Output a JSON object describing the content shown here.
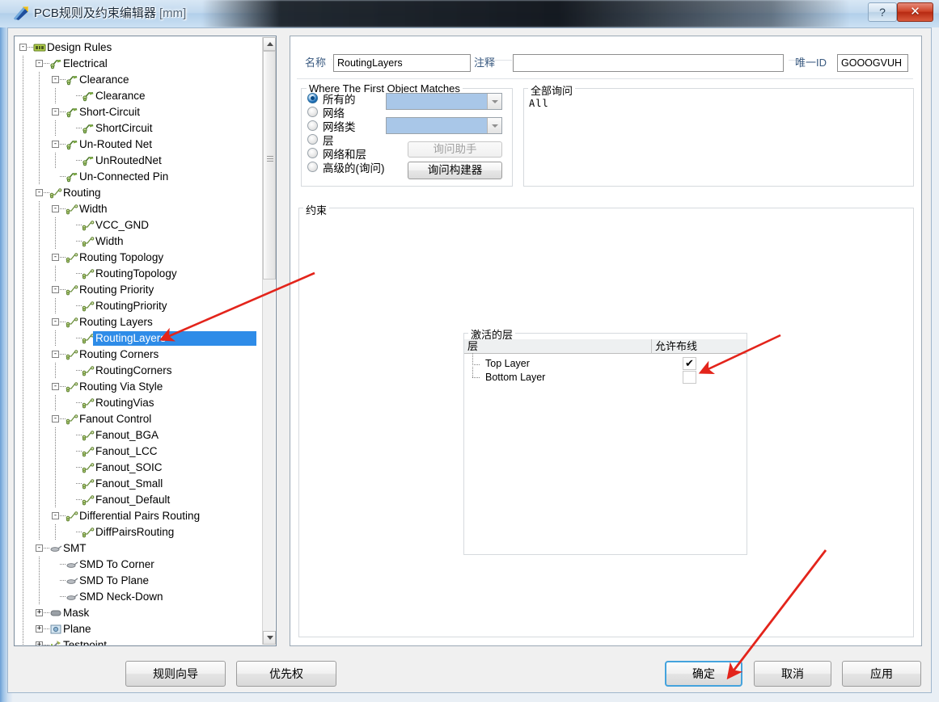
{
  "window": {
    "title": "PCB规则及约束编辑器",
    "unit": "[mm]",
    "icon": "pcb-rules-icon",
    "help_label": "?",
    "close_label": "✕"
  },
  "tree": {
    "items": [
      {
        "label": "Design Rules",
        "depth": 0,
        "expander": "-",
        "icon": "design-rules-icon"
      },
      {
        "label": "Electrical",
        "depth": 1,
        "expander": "-",
        "icon": "electrical-icon"
      },
      {
        "label": "Clearance",
        "depth": 2,
        "expander": "-",
        "icon": "electrical-icon"
      },
      {
        "label": "Clearance",
        "depth": 3,
        "expander": "",
        "icon": "electrical-icon"
      },
      {
        "label": "Short-Circuit",
        "depth": 2,
        "expander": "-",
        "icon": "electrical-icon"
      },
      {
        "label": "ShortCircuit",
        "depth": 3,
        "expander": "",
        "icon": "electrical-icon"
      },
      {
        "label": "Un-Routed Net",
        "depth": 2,
        "expander": "-",
        "icon": "electrical-icon"
      },
      {
        "label": "UnRoutedNet",
        "depth": 3,
        "expander": "",
        "icon": "electrical-icon"
      },
      {
        "label": "Un-Connected Pin",
        "depth": 2,
        "expander": "",
        "icon": "electrical-icon"
      },
      {
        "label": "Routing",
        "depth": 1,
        "expander": "-",
        "icon": "routing-icon"
      },
      {
        "label": "Width",
        "depth": 2,
        "expander": "-",
        "icon": "routing-icon"
      },
      {
        "label": "VCC_GND",
        "depth": 3,
        "expander": "",
        "icon": "routing-icon"
      },
      {
        "label": "Width",
        "depth": 3,
        "expander": "",
        "icon": "routing-icon"
      },
      {
        "label": "Routing Topology",
        "depth": 2,
        "expander": "-",
        "icon": "routing-icon"
      },
      {
        "label": "RoutingTopology",
        "depth": 3,
        "expander": "",
        "icon": "routing-icon"
      },
      {
        "label": "Routing Priority",
        "depth": 2,
        "expander": "-",
        "icon": "routing-icon"
      },
      {
        "label": "RoutingPriority",
        "depth": 3,
        "expander": "",
        "icon": "routing-icon"
      },
      {
        "label": "Routing Layers",
        "depth": 2,
        "expander": "-",
        "icon": "routing-icon"
      },
      {
        "label": "RoutingLayers",
        "depth": 3,
        "expander": "",
        "icon": "routing-icon",
        "selected": true
      },
      {
        "label": "Routing Corners",
        "depth": 2,
        "expander": "-",
        "icon": "routing-icon"
      },
      {
        "label": "RoutingCorners",
        "depth": 3,
        "expander": "",
        "icon": "routing-icon"
      },
      {
        "label": "Routing Via Style",
        "depth": 2,
        "expander": "-",
        "icon": "routing-icon"
      },
      {
        "label": "RoutingVias",
        "depth": 3,
        "expander": "",
        "icon": "routing-icon"
      },
      {
        "label": "Fanout Control",
        "depth": 2,
        "expander": "-",
        "icon": "routing-icon"
      },
      {
        "label": "Fanout_BGA",
        "depth": 3,
        "expander": "",
        "icon": "routing-icon"
      },
      {
        "label": "Fanout_LCC",
        "depth": 3,
        "expander": "",
        "icon": "routing-icon"
      },
      {
        "label": "Fanout_SOIC",
        "depth": 3,
        "expander": "",
        "icon": "routing-icon"
      },
      {
        "label": "Fanout_Small",
        "depth": 3,
        "expander": "",
        "icon": "routing-icon"
      },
      {
        "label": "Fanout_Default",
        "depth": 3,
        "expander": "",
        "icon": "routing-icon"
      },
      {
        "label": "Differential Pairs Routing",
        "depth": 2,
        "expander": "-",
        "icon": "routing-icon"
      },
      {
        "label": "DiffPairsRouting",
        "depth": 3,
        "expander": "",
        "icon": "routing-icon"
      },
      {
        "label": "SMT",
        "depth": 1,
        "expander": "-",
        "icon": "smt-icon"
      },
      {
        "label": "SMD To Corner",
        "depth": 2,
        "expander": "",
        "icon": "smt-icon"
      },
      {
        "label": "SMD To Plane",
        "depth": 2,
        "expander": "",
        "icon": "smt-icon"
      },
      {
        "label": "SMD Neck-Down",
        "depth": 2,
        "expander": "",
        "icon": "smt-icon"
      },
      {
        "label": "Mask",
        "depth": 1,
        "expander": "+",
        "icon": "mask-icon"
      },
      {
        "label": "Plane",
        "depth": 1,
        "expander": "+",
        "icon": "plane-icon"
      },
      {
        "label": "Testpoint",
        "depth": 1,
        "expander": "+",
        "icon": "testpoint-icon"
      }
    ]
  },
  "header": {
    "name_label": "名称",
    "name_value": "RoutingLayers",
    "comment_label": "注释",
    "comment_value": "",
    "unique_id_label": "唯一ID",
    "unique_id_value": "GOOOGVUH"
  },
  "match": {
    "group_title": "Where The First Object Matches",
    "options": [
      {
        "label": "所有的",
        "checked": true
      },
      {
        "label": "网络",
        "checked": false
      },
      {
        "label": "网络类",
        "checked": false
      },
      {
        "label": "层",
        "checked": false
      },
      {
        "label": "网络和层",
        "checked": false
      },
      {
        "label": "高级的(询问)",
        "checked": false
      }
    ],
    "combo1_value": "",
    "combo2_value": "",
    "query_helper_label": "询问助手",
    "query_builder_label": "询问构建器"
  },
  "full_query": {
    "group_title": "全部询问",
    "text": "All"
  },
  "constraints": {
    "group_title": "约束",
    "layers_group_title": "激活的层",
    "columns": [
      "层",
      "允许布线"
    ],
    "rows": [
      {
        "layer": "Top Layer",
        "allow_routing": true,
        "check_glyph": "✔"
      },
      {
        "layer": "Bottom Layer",
        "allow_routing": false,
        "check_glyph": ""
      }
    ]
  },
  "footer": {
    "rule_wizard_label": "规则向导",
    "priority_label": "优先权",
    "ok_label": "确定",
    "cancel_label": "取消",
    "apply_label": "应用"
  },
  "annotations": {
    "color": "#e3241b",
    "arrows": [
      {
        "name": "arrow-to-routing-layers-tree-item"
      },
      {
        "name": "arrow-to-bottom-layer-checkbox"
      },
      {
        "name": "arrow-to-ok-button"
      }
    ]
  }
}
